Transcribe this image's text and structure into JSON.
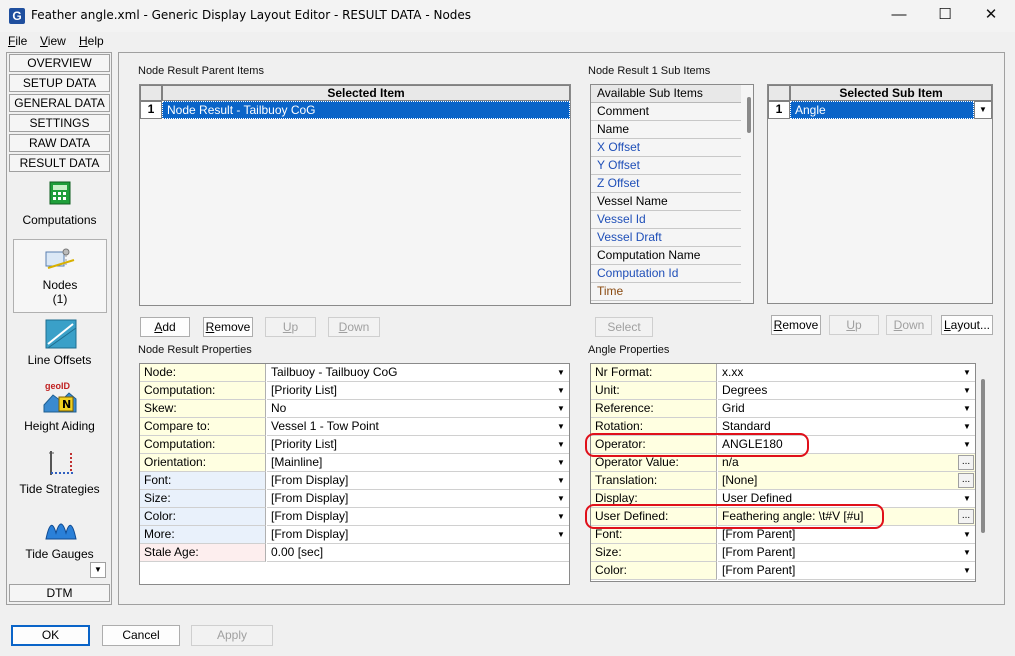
{
  "window": {
    "app_icon_letter": "G",
    "title": "Feather angle.xml - Generic Display Layout Editor -  RESULT DATA -  Nodes",
    "minimize_glyph": "—",
    "maximize_glyph": "☐",
    "close_glyph": "✕"
  },
  "menu": {
    "file": {
      "key": "F",
      "rest": "ile"
    },
    "view": {
      "key": "V",
      "rest": "iew"
    },
    "help": {
      "key": "H",
      "rest": "elp"
    }
  },
  "nav": {
    "overview": "OVERVIEW",
    "setup_data": "SETUP DATA",
    "general_data": "GENERAL DATA",
    "settings": "SETTINGS",
    "raw_data": "RAW DATA",
    "result_data": "RESULT DATA",
    "dtm": "DTM"
  },
  "tools": {
    "computations": "Computations",
    "nodes": "Nodes",
    "nodes_count": "(1)",
    "line_offsets": "Line Offsets",
    "height_aiding": "Height Aiding",
    "geoid_text": "geoID",
    "tide_strategies": "Tide Strategies",
    "tide_gauges": "Tide Gauges",
    "scroll_glyph": "▼"
  },
  "parent_items": {
    "label": "Node Result Parent Items",
    "header": "Selected Item",
    "rows": [
      {
        "num": "1",
        "value": "Node Result  -  Tailbuoy CoG"
      }
    ],
    "add": {
      "key": "A",
      "rest": "dd"
    },
    "remove": {
      "key": "R",
      "rest": "emove"
    },
    "up": {
      "key": "U",
      "rest": "p"
    },
    "down": {
      "key": "D",
      "rest": "own"
    }
  },
  "sub_items": {
    "label": "Node Result 1 Sub Items",
    "available_header": "Available Sub Items",
    "available": [
      {
        "text": "Comment",
        "style": ""
      },
      {
        "text": "Name",
        "style": ""
      },
      {
        "text": "X Offset",
        "style": "blue"
      },
      {
        "text": "Y Offset",
        "style": "blue"
      },
      {
        "text": "Z Offset",
        "style": "blue"
      },
      {
        "text": "Vessel Name",
        "style": ""
      },
      {
        "text": "Vessel Id",
        "style": "blue"
      },
      {
        "text": "Vessel Draft",
        "style": "blue"
      },
      {
        "text": "Computation Name",
        "style": ""
      },
      {
        "text": "Computation Id",
        "style": "blue"
      },
      {
        "text": "Time",
        "style": "brown"
      }
    ],
    "select": "Select",
    "selected_header": "Selected Sub Item",
    "selected_rows": [
      {
        "num": "1",
        "value": "Angle"
      }
    ],
    "remove": {
      "key": "R",
      "rest": "emove"
    },
    "up": {
      "key": "U",
      "rest": "p"
    },
    "down": {
      "key": "D",
      "rest": "own"
    },
    "layout": {
      "key": "L",
      "rest": "ayout..."
    }
  },
  "node_props": {
    "label": "Node Result Properties",
    "rows": [
      {
        "name": "Node:",
        "value": "Tailbuoy - Tailbuoy CoG",
        "name_style": "",
        "dropdown": true
      },
      {
        "name": "Computation:",
        "value": "[Priority List]",
        "name_style": "",
        "dropdown": true
      },
      {
        "name": "Skew:",
        "value": "No",
        "name_style": "",
        "dropdown": true
      },
      {
        "name": "Compare to:",
        "value": "Vessel 1 - Tow Point",
        "name_style": "",
        "dropdown": true
      },
      {
        "name": "Computation:",
        "value": "[Priority List]",
        "name_style": "",
        "dropdown": true
      },
      {
        "name": "Orientation:",
        "value": "[Mainline]",
        "name_style": "",
        "dropdown": true
      },
      {
        "name": "Font:",
        "value": "[From Display]",
        "name_style": "blue",
        "dropdown": true
      },
      {
        "name": "Size:",
        "value": "[From Display]",
        "name_style": "blue",
        "dropdown": true
      },
      {
        "name": "Color:",
        "value": "[From Display]",
        "name_style": "blue",
        "dropdown": true
      },
      {
        "name": "More:",
        "value": "[From Display]",
        "name_style": "blue",
        "dropdown": true
      },
      {
        "name": "Stale Age:",
        "value": "0.00 [sec]",
        "name_style": "pink",
        "dropdown": false
      }
    ]
  },
  "angle_props": {
    "label": "Angle Properties",
    "rows": [
      {
        "name": "Nr Format:",
        "value": "x.xx",
        "control": "dropdown",
        "cream": false
      },
      {
        "name": "Unit:",
        "value": "Degrees",
        "control": "dropdown",
        "cream": false
      },
      {
        "name": "Reference:",
        "value": "Grid",
        "control": "dropdown",
        "cream": false
      },
      {
        "name": "Rotation:",
        "value": "Standard",
        "control": "dropdown",
        "cream": false
      },
      {
        "name": "Operator:",
        "value": "ANGLE180",
        "control": "dropdown",
        "cream": false
      },
      {
        "name": "Operator Value:",
        "value": "n/a",
        "control": "ellipsis",
        "cream": true
      },
      {
        "name": "Translation:",
        "value": "[None]",
        "control": "ellipsis",
        "cream": true
      },
      {
        "name": "Display:",
        "value": "User Defined",
        "control": "dropdown",
        "cream": false
      },
      {
        "name": "User Defined:",
        "value": "Feathering angle: \\t#V [#u]",
        "control": "ellipsis",
        "cream": true
      },
      {
        "name": "Font:",
        "value": "[From Parent]",
        "control": "dropdown",
        "cream": false
      },
      {
        "name": "Size:",
        "value": "[From Parent]",
        "control": "dropdown",
        "cream": false
      },
      {
        "name": "Color:",
        "value": "[From Parent]",
        "control": "dropdown",
        "cream": false
      }
    ]
  },
  "footer": {
    "ok": "OK",
    "cancel": "Cancel",
    "apply": "Apply"
  },
  "icons": {
    "dropdown_glyph": "▼",
    "ellipsis_glyph": "..."
  }
}
